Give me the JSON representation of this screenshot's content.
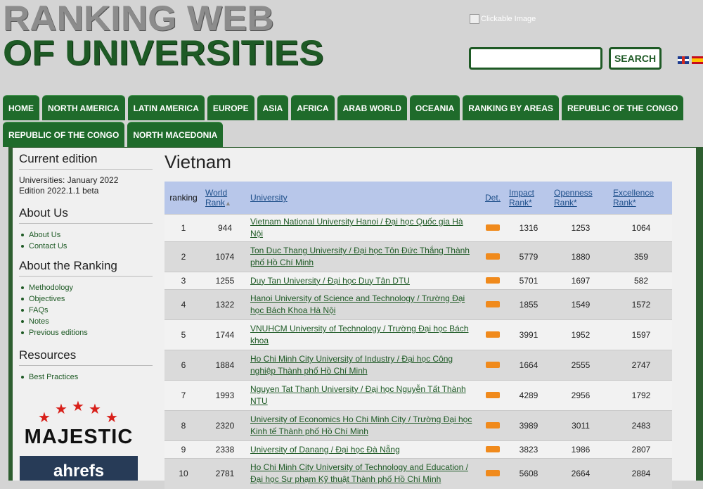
{
  "logo": {
    "line1": "RANKING WEB",
    "line2": "OF UNIVERSITIES"
  },
  "clickable_image_alt": "Clickable Image",
  "search": {
    "button_label": "SEARCH",
    "value": ""
  },
  "nav": {
    "row1": [
      "HOME",
      "NORTH AMERICA",
      "LATIN AMERICA",
      "EUROPE",
      "ASIA",
      "AFRICA",
      "ARAB WORLD",
      "OCEANIA",
      "RANKING BY AREAS",
      "REPUBLIC OF THE CONGO"
    ],
    "row2": [
      "REPUBLIC OF THE CONGO",
      "NORTH MACEDONIA"
    ]
  },
  "sidebar": {
    "current_edition": {
      "heading": "Current edition",
      "line1": "Universities: January 2022",
      "line2": "Edition 2022.1.1 beta"
    },
    "about_us": {
      "heading": "About Us",
      "items": [
        "About Us",
        "Contact Us"
      ]
    },
    "about_ranking": {
      "heading": "About the Ranking",
      "items": [
        "Methodology",
        "Objectives",
        "FAQs",
        "Notes",
        "Previous editions"
      ]
    },
    "resources": {
      "heading": "Resources",
      "items": [
        "Best Practices"
      ]
    },
    "sponsors": {
      "majestic": "MAJESTIC",
      "ahrefs": "ahrefs"
    }
  },
  "page_title": "Vietnam",
  "table": {
    "headers": {
      "ranking": "ranking",
      "world_rank_1": "World",
      "world_rank_2": "Rank",
      "university": "University",
      "det": "Det.",
      "impact_1": "Impact",
      "impact_2": "Rank*",
      "openness_1": "Openness",
      "openness_2": "Rank*",
      "excellence_1": "Excellence",
      "excellence_2": "Rank*"
    },
    "rows": [
      {
        "rank": "1",
        "world": "944",
        "name": "Vietnam National University Hanoi / Đại học Quốc gia Hà Nội",
        "impact": "1316",
        "openness": "1253",
        "excellence": "1064"
      },
      {
        "rank": "2",
        "world": "1074",
        "name": "Ton Duc Thang University / Đại học Tôn Đức Thắng Thành phố Hồ Chí Minh",
        "impact": "5779",
        "openness": "1880",
        "excellence": "359"
      },
      {
        "rank": "3",
        "world": "1255",
        "name": "Duy Tan University / Đại học Duy Tân DTU",
        "impact": "5701",
        "openness": "1697",
        "excellence": "582"
      },
      {
        "rank": "4",
        "world": "1322",
        "name": "Hanoi University of Science and Technology / Trường Đại học Bách Khoa Hà Nội",
        "impact": "1855",
        "openness": "1549",
        "excellence": "1572"
      },
      {
        "rank": "5",
        "world": "1744",
        "name": "VNUHCM University of Technology / Trường Đại học Bách khoa",
        "impact": "3991",
        "openness": "1952",
        "excellence": "1597"
      },
      {
        "rank": "6",
        "world": "1884",
        "name": "Ho Chi Minh City University of Industry / Đại học Công nghiệp Thành phố Hồ Chí Minh",
        "impact": "1664",
        "openness": "2555",
        "excellence": "2747"
      },
      {
        "rank": "7",
        "world": "1993",
        "name": "Nguyen Tat Thanh University / Đại học Nguyễn Tất Thành NTU",
        "impact": "4289",
        "openness": "2956",
        "excellence": "1792"
      },
      {
        "rank": "8",
        "world": "2320",
        "name": "University of Economics Ho Chi Minh City / Trường Đại học Kinh tế Thành phố Hồ Chí Minh",
        "impact": "3989",
        "openness": "3011",
        "excellence": "2483"
      },
      {
        "rank": "9",
        "world": "2338",
        "name": "University of Danang / Đại học Đà Nẵng",
        "impact": "3823",
        "openness": "1986",
        "excellence": "2807"
      },
      {
        "rank": "10",
        "world": "2781",
        "name": "Ho Chi Minh City University of Technology and Education / Đại học Sư phạm Kỹ thuật Thành phố Hồ Chí Minh",
        "impact": "5608",
        "openness": "2664",
        "excellence": "2884"
      }
    ]
  },
  "colors": {
    "brand_green": "#1e5a25",
    "nav_green": "#1f6b2b",
    "header_blue": "#b8c7ea",
    "det_orange": "#f08a1c"
  }
}
